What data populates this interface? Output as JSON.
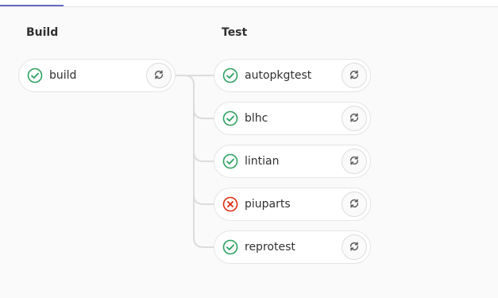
{
  "colors": {
    "success": "#2da160",
    "failed": "#dd2b0e",
    "connector": "#dcdcdc",
    "tab_indicator": "#6666c4"
  },
  "stages": [
    {
      "title": "Build",
      "jobs": [
        {
          "name": "build",
          "status": "success",
          "status_icon": "check-circle-icon",
          "action_icon": "retry-icon"
        }
      ]
    },
    {
      "title": "Test",
      "jobs": [
        {
          "name": "autopkgtest",
          "status": "success",
          "status_icon": "check-circle-icon",
          "action_icon": "retry-icon"
        },
        {
          "name": "blhc",
          "status": "success",
          "status_icon": "check-circle-icon",
          "action_icon": "retry-icon"
        },
        {
          "name": "lintian",
          "status": "success",
          "status_icon": "check-circle-icon",
          "action_icon": "retry-icon"
        },
        {
          "name": "piuparts",
          "status": "failed",
          "status_icon": "x-circle-icon",
          "action_icon": "retry-icon"
        },
        {
          "name": "reprotest",
          "status": "success",
          "status_icon": "check-circle-icon",
          "action_icon": "retry-icon"
        }
      ]
    }
  ]
}
